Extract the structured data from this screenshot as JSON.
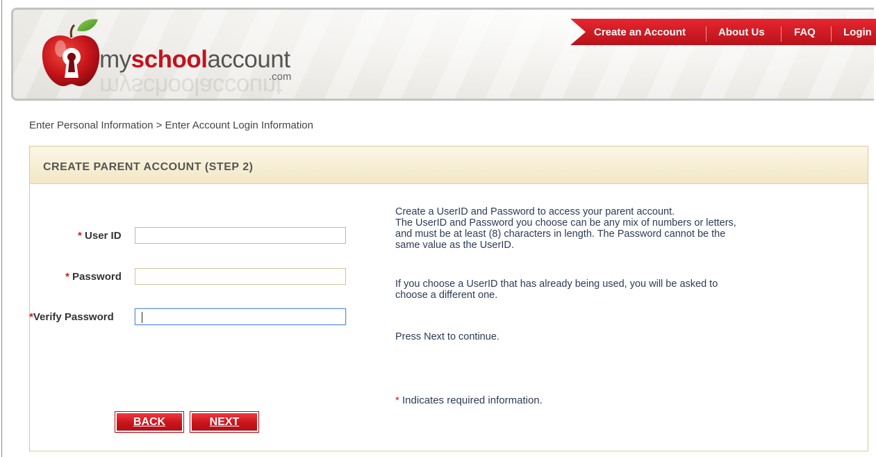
{
  "brand": {
    "prefix": "my",
    "bold": "school",
    "suffix": "account",
    "tld": ".com"
  },
  "nav": {
    "items": [
      "Create an Account",
      "About Us",
      "FAQ",
      "Login"
    ]
  },
  "breadcrumb": "Enter Personal Information > Enter Account Login Information",
  "panel": {
    "title": "CREATE PARENT ACCOUNT (STEP 2)"
  },
  "form": {
    "required_mark": "*",
    "userid_label": "User ID",
    "password_label": "Password",
    "verify_label": "Verify Password",
    "userid_value": "",
    "password_value": "",
    "verify_value": ""
  },
  "help": {
    "line1": "Create a UserID and Password to access your parent account.",
    "line2": "The UserID and Password you choose can be any mix of numbers or letters,",
    "line3": "and must be at least (8) characters in length. The Password cannot be the",
    "line4": "same value as the UserID.",
    "line5": "If you choose a UserID that has already being used, you will be asked to",
    "line6": "choose a different one.",
    "line7": "Press Next to continue.",
    "required_note": "Indicates required information."
  },
  "buttons": {
    "back": "BACK",
    "next": "NEXT"
  },
  "colors": {
    "accent_red": "#c4121c",
    "panel_border": "#d8c9a2",
    "help_text": "#2d3b56"
  }
}
